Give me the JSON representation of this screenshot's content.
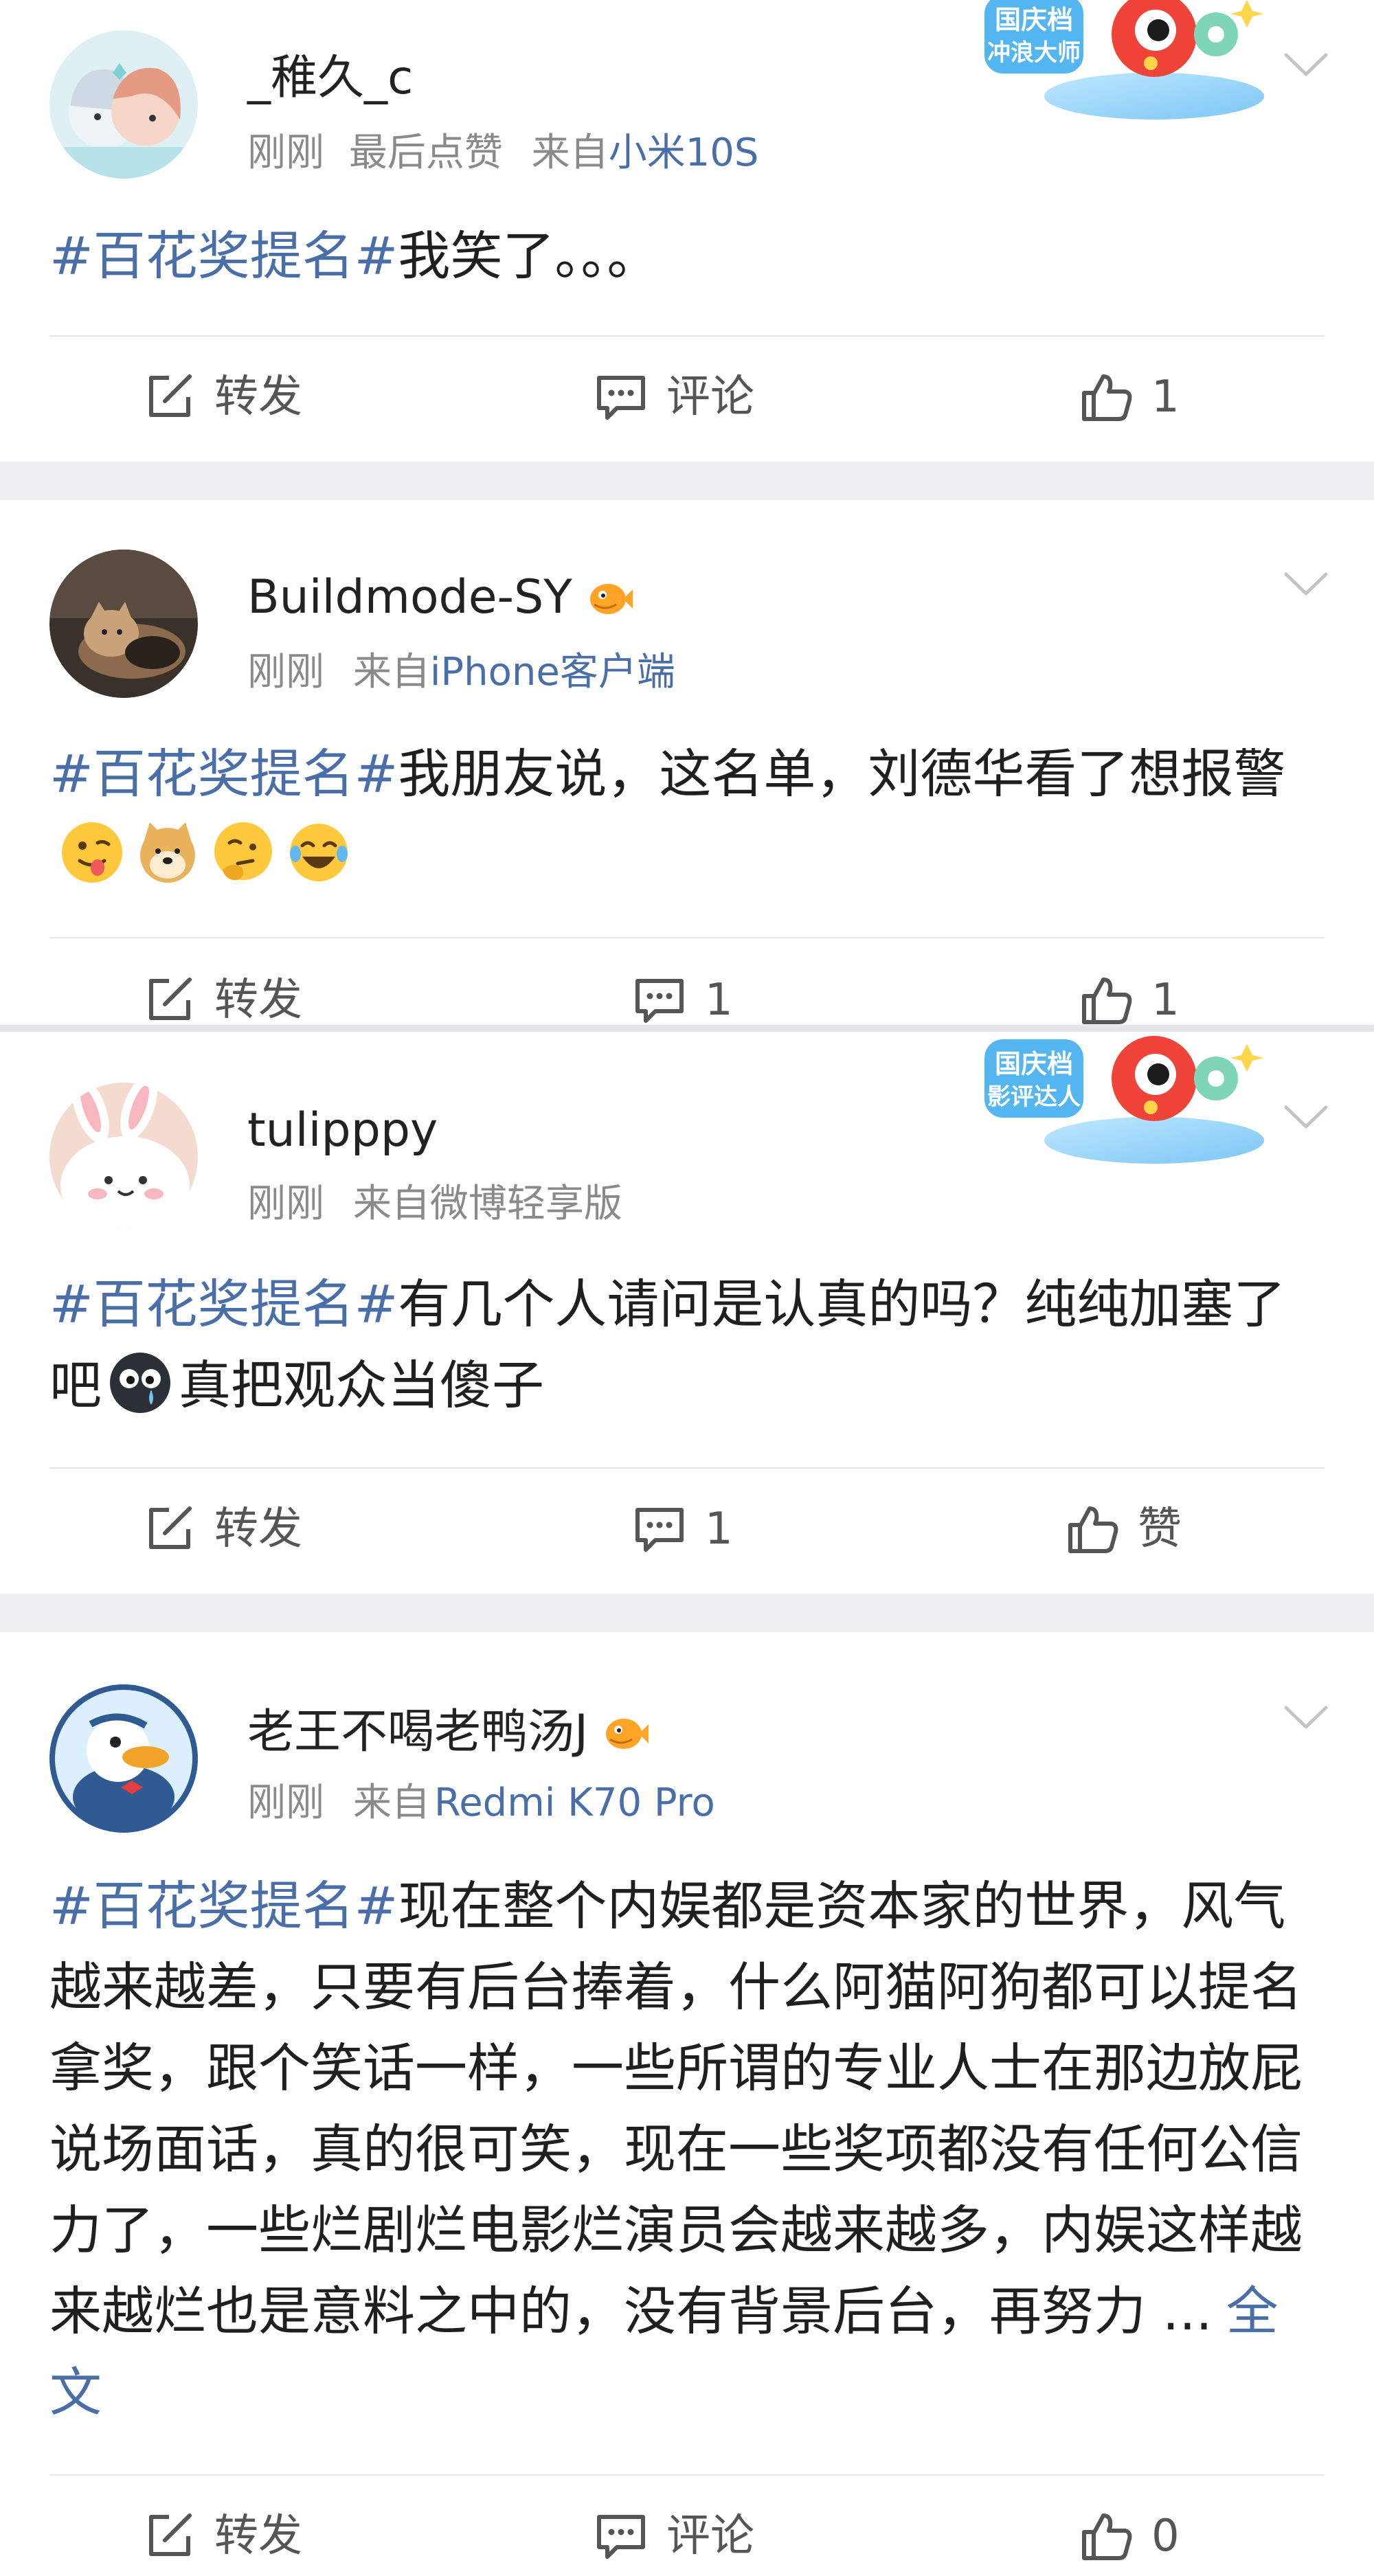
{
  "posts": [
    {
      "username": "_稚久_c",
      "meta_time": "刚刚",
      "meta_extra": "最后点赞",
      "meta_from": "来自",
      "device": "小米10S",
      "hashtag": "#百花奖提名#",
      "text": "我笑了。。。",
      "badge": {
        "line1": "国庆档",
        "line2": "冲浪大师"
      },
      "actions": {
        "repost": "转发",
        "comment": "评论",
        "like": "1"
      }
    },
    {
      "username": "Buildmode-SY",
      "meta_time": "刚刚",
      "meta_from": "来自",
      "device": "iPhone客户端",
      "hashtag": "#百花奖提名#",
      "text": "我朋友说，这名单，刘德华看了想报警",
      "emojis": [
        "tongue-emoji",
        "doge-emoji",
        "thinking-emoji",
        "laugh-cry-emoji"
      ],
      "actions": {
        "repost": "转发",
        "comment": "1",
        "like": "1"
      }
    },
    {
      "username": "tulipppy",
      "meta_time": "刚刚",
      "meta_from": "来自",
      "device": "微博轻享版",
      "hashtag": "#百花奖提名#",
      "text": "有几个人请问是认真的吗？纯纯加塞了吧",
      "text_after": "真把观众当傻子",
      "badge": {
        "line1": "国庆档",
        "line2": "影评达人"
      },
      "actions": {
        "repost": "转发",
        "comment": "1",
        "like": "赞"
      }
    },
    {
      "username": "老王不喝老鸭汤J",
      "meta_time": "刚刚",
      "meta_from": "来自",
      "device": "Redmi K70 Pro",
      "hashtag": "#百花奖提名#",
      "text": "现在整个内娱都是资本家的世界，风气越来越差，只要有后台捧着，什么阿猫阿狗都可以提名拿奖，跟个笑话一样，一些所谓的专业人士在那边放屁说场面话，真的很可笑，现在一些奖项都没有任何公信力了，一些烂剧烂电影烂演员会越来越多，内娱这样越来越烂也是意料之中的，没有背景后台，再努力 ...",
      "full_text_link": "全文",
      "actions": {
        "repost": "转发",
        "comment": "评论",
        "like": "0"
      }
    }
  ],
  "colors": {
    "link": "#4a6ea8",
    "meta": "#8a8a8a",
    "text": "#1f1f1f",
    "separator": "#efeff1"
  }
}
